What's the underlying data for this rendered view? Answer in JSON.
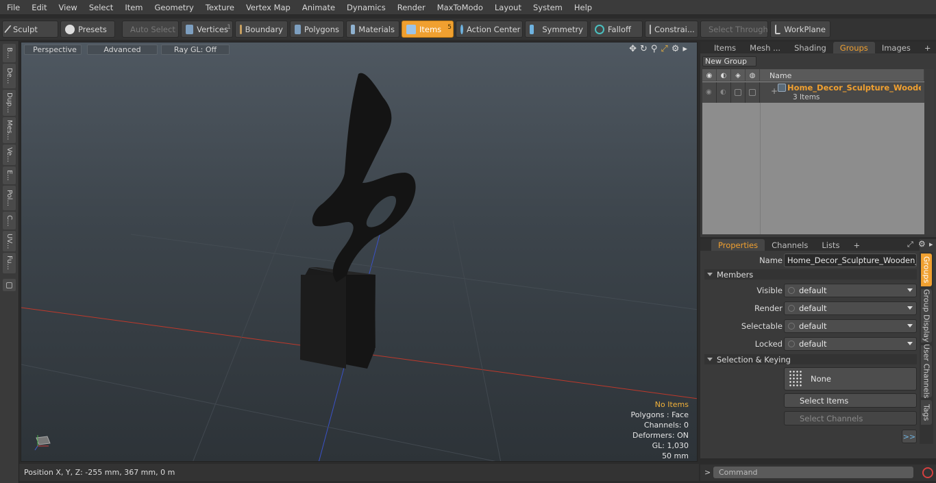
{
  "menu": [
    "File",
    "Edit",
    "View",
    "Select",
    "Item",
    "Geometry",
    "Texture",
    "Vertex Map",
    "Animate",
    "Dynamics",
    "Render",
    "MaxToModo",
    "Layout",
    "System",
    "Help"
  ],
  "toolbar": {
    "sculpt": "Sculpt",
    "presets": "Presets",
    "auto_select": "Auto Select",
    "vertices": "Vertices",
    "vertices_badge": "1",
    "boundary": "Boundary",
    "polygons": "Polygons",
    "materials": "Materials",
    "items": "Items",
    "items_badge": "5",
    "action_center": "Action Center",
    "symmetry": "Symmetry",
    "falloff": "Falloff",
    "constraints": "Constrai...",
    "select_through": "Select Through",
    "workplane": "WorkPlane"
  },
  "left_tabs": [
    "B...",
    "De...",
    "Dup...",
    "Mes...",
    "Ve...",
    "E...",
    "Pol...",
    "C...",
    "UV...",
    "Fu..."
  ],
  "viewport": {
    "perspective": "Perspective",
    "advanced": "Advanced",
    "raygl": "Ray GL: Off",
    "hud": {
      "items": "No Items",
      "polygons": "Polygons : Face",
      "channels": "Channels: 0",
      "deformers": "Deformers: ON",
      "gl": "GL: 1,030",
      "scale": "50 mm"
    }
  },
  "status": {
    "position": "Position X, Y, Z:   -255 mm, 367 mm, 0 m"
  },
  "groups_panel": {
    "tabs": [
      "Items",
      "Mesh ...",
      "Shading",
      "Groups",
      "Images"
    ],
    "active_tab": "Groups",
    "new_group": "New Group",
    "col_name": "Name",
    "group": {
      "name": "Home_Decor_Sculpture_Woode ...",
      "count": "3 Items"
    }
  },
  "properties_panel": {
    "tabs": [
      "Properties",
      "Channels",
      "Lists"
    ],
    "name_label": "Name",
    "name_value": "Home_Decor_Sculpture_Wooden_Blac",
    "members_label": "Members",
    "visible_label": "Visible",
    "visible_value": "default",
    "render_label": "Render",
    "render_value": "default",
    "selectable_label": "Selectable",
    "selectable_value": "default",
    "locked_label": "Locked",
    "locked_value": "default",
    "sel_keying_label": "Selection & Keying",
    "none_label": "None",
    "select_items": "Select Items",
    "select_channels": "Select Channels",
    "more": ">>",
    "vertical_tabs": [
      "Groups",
      "Group Display",
      "User Channels",
      "Tags"
    ]
  },
  "command": {
    "placeholder": "Command"
  },
  "colors": {
    "accent": "#f0a030"
  }
}
